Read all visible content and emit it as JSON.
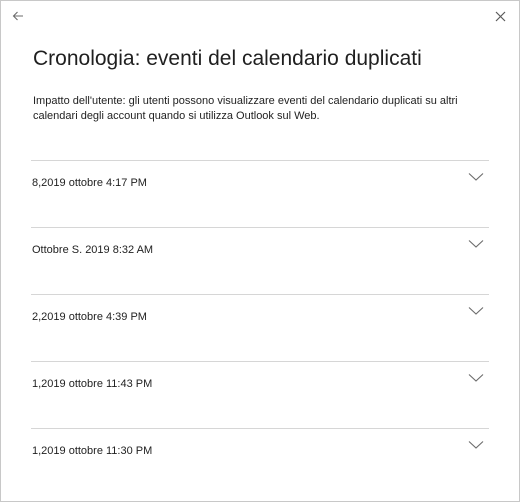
{
  "header": {
    "back_icon": "arrow-left-icon",
    "close_icon": "close-icon"
  },
  "title": "Cronologia: eventi del calendario duplicati",
  "impact_text": "Impatto dell'utente: gli utenti possono visualizzare eventi del calendario duplicati su altri calendari degli account quando si utilizza Outlook sul Web.",
  "history": [
    {
      "label": "8,2019 ottobre 4:17 PM",
      "icon": "chevron-down-icon"
    },
    {
      "label": "Ottobre S. 2019 8:32 AM",
      "icon": "chevron-down-icon"
    },
    {
      "label": "2,2019 ottobre 4:39 PM",
      "icon": "chevron-down-icon"
    },
    {
      "label": "1,2019 ottobre 11:43 PM",
      "icon": "chevron-down-icon"
    },
    {
      "label": "1,2019 ottobre 11:30 PM",
      "icon": "chevron-down-icon"
    }
  ],
  "colors": {
    "text": "#1f1f1f",
    "icon": "#6b6b6b",
    "divider": "#d6d6d6",
    "border": "#c8c8c8"
  }
}
